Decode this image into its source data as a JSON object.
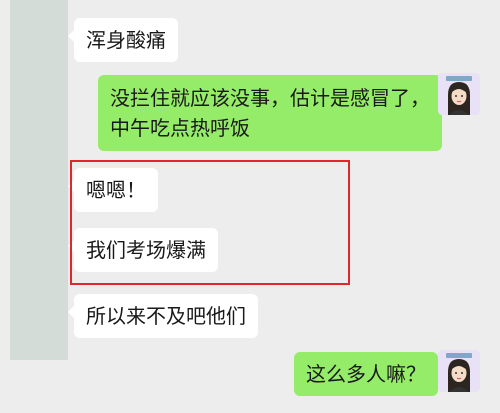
{
  "messages": [
    {
      "side": "in",
      "lines": [
        "浑身酸痛"
      ]
    },
    {
      "side": "out",
      "lines": [
        "没拦住就应该没事，估计是感冒了，",
        "中午吃点热呼饭"
      ]
    },
    {
      "side": "in",
      "lines": [
        "嗯嗯！"
      ]
    },
    {
      "side": "in",
      "lines": [
        "我们考场爆满"
      ]
    },
    {
      "side": "in",
      "lines": [
        "所以来不及吧他们"
      ]
    },
    {
      "side": "out",
      "lines": [
        "这么多人嘛？"
      ]
    }
  ],
  "colors": {
    "background": "#ededed",
    "incoming_bubble": "#ffffff",
    "outgoing_bubble": "#95ec69",
    "highlight_border": "#e1262d"
  }
}
